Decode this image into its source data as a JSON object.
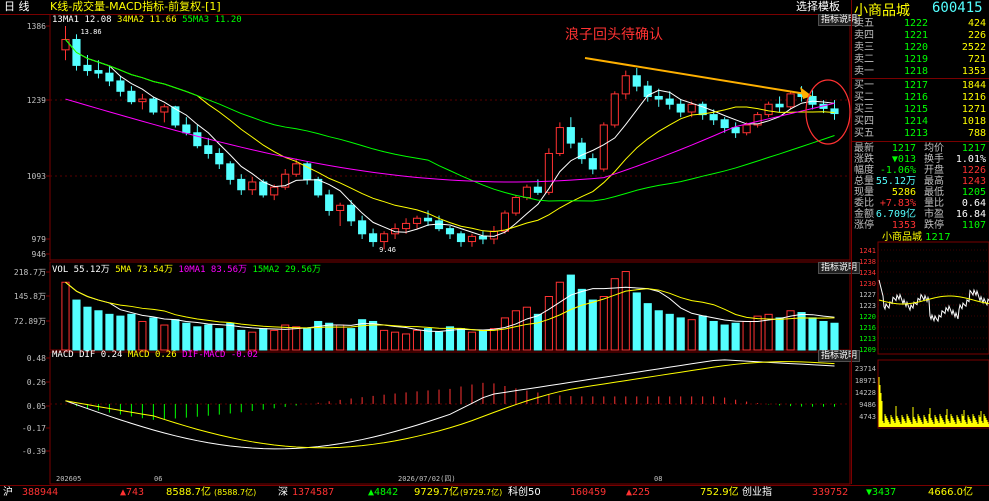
{
  "header": {
    "mode_label": "日 线",
    "title": "K线-成交量-MACD指标-前复权-[1]",
    "select_template": "选择模板",
    "indicator_help": "指标说明",
    "stock_name": "小商品城",
    "stock_code": "600415"
  },
  "main_chart": {
    "ma_legend": [
      "13MA1 12.08",
      "34MA2 11.66",
      "55MA3 11.20"
    ],
    "y_ticks": [
      "1386",
      "1239",
      "1093",
      "979",
      "946"
    ],
    "high_label": "13.86",
    "low_label": "9.46",
    "annotation": "浪子回头待确认"
  },
  "volume_chart": {
    "legend": [
      "VOL 55.12万",
      "5MA 73.54万",
      "10MA1 83.56万",
      "15MA2 29.56万"
    ],
    "y_ticks": [
      "218.7万",
      "145.8万",
      "72.89万"
    ],
    "indicator_help": "指标说明"
  },
  "macd_chart": {
    "legend": [
      "MACD DIF 0.24",
      "MACD 0.26",
      "DIF-MACD -0.02"
    ],
    "y_ticks": [
      "0.48",
      "0.26",
      "0.05",
      "-0.17",
      "-0.39"
    ],
    "indicator_help": "指标说明"
  },
  "x_axis": {
    "labels": [
      "202605",
      "06",
      "2026/07/02(四)",
      "08"
    ]
  },
  "order_book": {
    "asks": [
      {
        "label": "卖五",
        "price": "1222",
        "vol": "424"
      },
      {
        "label": "卖四",
        "price": "1221",
        "vol": "226"
      },
      {
        "label": "卖三",
        "price": "1220",
        "vol": "2522"
      },
      {
        "label": "卖二",
        "price": "1219",
        "vol": "721"
      },
      {
        "label": "卖一",
        "price": "1218",
        "vol": "1353"
      }
    ],
    "bids": [
      {
        "label": "买一",
        "price": "1217",
        "vol": "1844"
      },
      {
        "label": "买二",
        "price": "1216",
        "vol": "1216"
      },
      {
        "label": "买三",
        "price": "1215",
        "vol": "1271"
      },
      {
        "label": "买四",
        "price": "1214",
        "vol": "1018"
      },
      {
        "label": "买五",
        "price": "1213",
        "vol": "788"
      }
    ]
  },
  "stats": [
    {
      "l1": "最新",
      "v1": "1217",
      "l2": "均价",
      "v2": "1217"
    },
    {
      "l1": "涨跌",
      "v1": "▼013",
      "l2": "换手",
      "v2": "1.01%"
    },
    {
      "l1": "幅度",
      "v1": "-1.06%",
      "l2": "开盘",
      "v2": "1226"
    },
    {
      "l1": "总量",
      "v1": "55.12万",
      "l2": "最高",
      "v2": "1243"
    },
    {
      "l1": "现量",
      "v1": "5286",
      "l2": "最低",
      "v2": "1205"
    },
    {
      "l1": "委比",
      "v1": "+7.83%",
      "l2": "量比",
      "v2": "0.64"
    },
    {
      "l1": "金额",
      "v1": "6.709亿",
      "l2": "市盈",
      "v2": "16.84"
    },
    {
      "l1": "涨停",
      "v1": "1353",
      "l2": "跌停",
      "v2": "1107"
    }
  ],
  "minute_chart": {
    "title": "小商品城",
    "price": "1217",
    "price_ticks": [
      "1241",
      "1238",
      "1234",
      "1230",
      "1227",
      "1223",
      "1220",
      "1216",
      "1213",
      "1209"
    ],
    "vol_ticks": [
      "23714",
      "18971",
      "14228",
      "9486",
      "4743"
    ]
  },
  "status_bar": {
    "sh_label": "沪",
    "sh_value": "388944",
    "sh_change": "▲743",
    "sh_amount": "8588.7亿",
    "sh_amount2": "(8588.7亿)",
    "sz_label": "深",
    "sz_value": "1374587",
    "sz_change": "▲4842",
    "sz_amount": "9729.7亿",
    "sz_amount2": "(9729.7亿)",
    "kc_label": "科创50",
    "kc_value": "160459",
    "kc_change": "▲225",
    "kc_amount": "752.9亿",
    "cy_label": "创业指",
    "cy_value": "339752",
    "cy_change": "▼3437",
    "cy_amount": "4666.0亿"
  },
  "colors": {
    "up": "#ff3232",
    "down": "#54ffff",
    "ma1": "#ffffff",
    "ma2": "#ffff00",
    "ma3": "#ff00ff",
    "ma4": "#00ff00",
    "frame": "#7a0000",
    "label_yellow": "#ffff00"
  }
}
